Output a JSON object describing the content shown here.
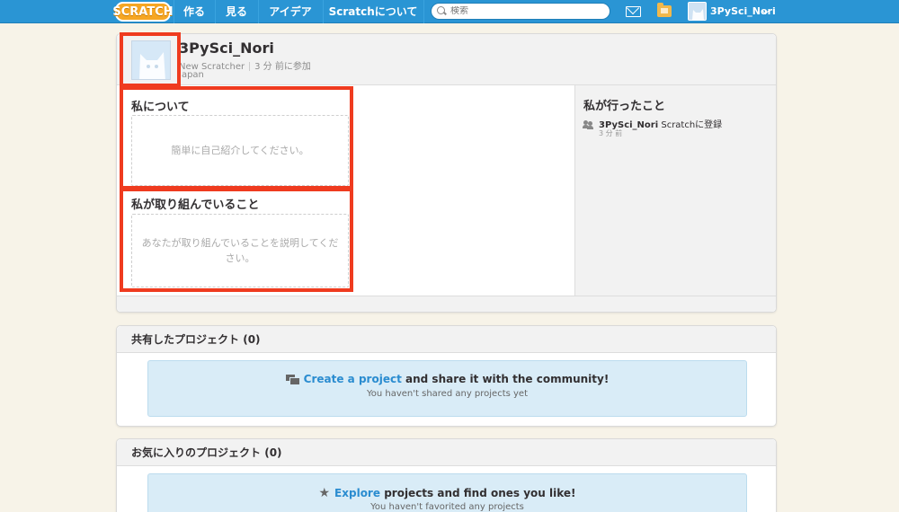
{
  "topbar": {
    "logo": "SCRATCH",
    "nav": [
      "作る",
      "見る",
      "アイデア",
      "Scratchについて"
    ],
    "search_placeholder": "検索",
    "user_name": "3PySci_Nori",
    "colors": {
      "bar": "#2a95d4",
      "logo": "#f6a623"
    }
  },
  "profile": {
    "username": "3PySci_Nori",
    "rank": "New Scratcher",
    "joined": "3 分 前に参加",
    "country": "Japan",
    "about_title": "私について",
    "about_placeholder": "簡単に自己紹介してください。",
    "working_title": "私が取り組んでいること",
    "working_placeholder": "あなたが取り組んでいることを説明してください。",
    "activity_title": "私が行ったこと",
    "activity": {
      "user": "3PySci_Nori",
      "action": "Scratchに登録",
      "time": "3 分 前"
    }
  },
  "shared": {
    "title": "共有したプロジェクト",
    "count": "(0)",
    "link": "Create a project",
    "text": "and share it with the community!",
    "sub": "You haven't shared any projects yet"
  },
  "favorites": {
    "title": "お気に入りのプロジェクト",
    "count": "(0)",
    "link": "Explore",
    "text": "projects and find ones you like!",
    "sub": "You haven't favorited any projects"
  },
  "highlight_color": "#ef3b1f"
}
